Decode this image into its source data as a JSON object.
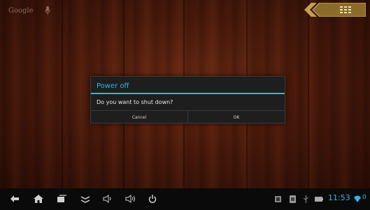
{
  "top_bar": {
    "search_label": "Google",
    "mic": "mic-icon",
    "apps": "apps-grid-icon"
  },
  "dialog": {
    "title": "Power off",
    "message": "Do you want to shut down?",
    "cancel_label": "Cancel",
    "ok_label": "OK"
  },
  "nav_bar": {
    "icons": [
      "back-icon",
      "home-icon",
      "recent-apps-icon",
      "menu-chevron-icon",
      "volume-down-icon",
      "volume-up-icon",
      "power-icon"
    ],
    "status_icons": [
      "screenshot-icon",
      "notification-icon",
      "usb-icon",
      "battery-icon",
      "wifi-icon"
    ],
    "time": "11:53"
  },
  "colors": {
    "accent": "#33b5e5",
    "dialog_bg": "#1e1e1e",
    "nav_bg": "#0a0a0a",
    "wood": "#4a1a0b"
  }
}
